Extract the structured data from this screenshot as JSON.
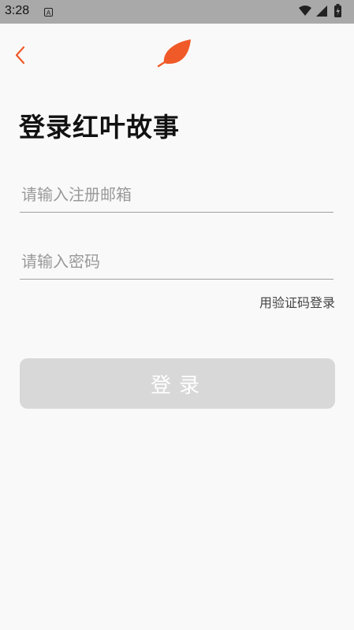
{
  "status_bar": {
    "time": "3:28",
    "notification_icon_letter": "A",
    "icons": [
      "wifi-icon",
      "signal-icon",
      "battery-charging-icon"
    ]
  },
  "header": {
    "back_icon": "chevron-left-icon",
    "logo_icon": "leaf-icon"
  },
  "colors": {
    "accent": "#f05a28",
    "button_disabled": "#d8d8d8",
    "divider": "#a0a0a0"
  },
  "login": {
    "title": "登录红叶故事",
    "email_placeholder": "请输入注册邮箱",
    "email_value": "",
    "password_placeholder": "请输入密码",
    "password_value": "",
    "sms_login_link": "用验证码登录",
    "login_button": "登录"
  }
}
